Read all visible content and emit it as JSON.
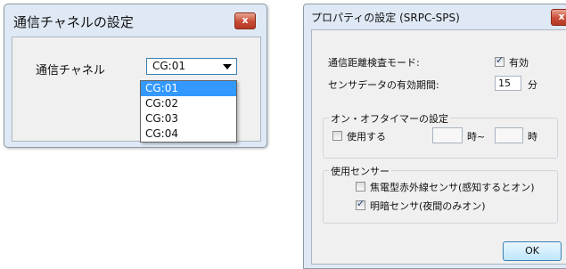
{
  "dialog1": {
    "title": "通信チャネルの設定",
    "close_label": "x",
    "channel_label": "通信チャネル",
    "combo_value": "CG:01",
    "options": [
      "CG:01",
      "CG:02",
      "CG:03",
      "CG:04"
    ],
    "selected_index": 0
  },
  "dialog2": {
    "title": "プロパティの設定 (SRPC-SPS)",
    "close_label": "x",
    "distance_mode_label": "通信距離検査モード:",
    "distance_mode_check_label": "有効",
    "distance_mode_checked": true,
    "sensor_period_label": "センサデータの有効期間:",
    "sensor_period_value": "15",
    "sensor_period_unit": "分",
    "timer_group": {
      "legend": "オン・オフタイマーの設定",
      "use_label": "使用する",
      "use_checked": false,
      "from_unit": "時~",
      "to_unit": "時"
    },
    "sensor_group": {
      "legend": "使用センサー",
      "items": [
        {
          "label": "焦電型赤外線センサ(感知するとオン)",
          "checked": false
        },
        {
          "label": "明暗センサ(夜間のみオン)",
          "checked": true
        }
      ]
    },
    "ok_label": "OK"
  }
}
